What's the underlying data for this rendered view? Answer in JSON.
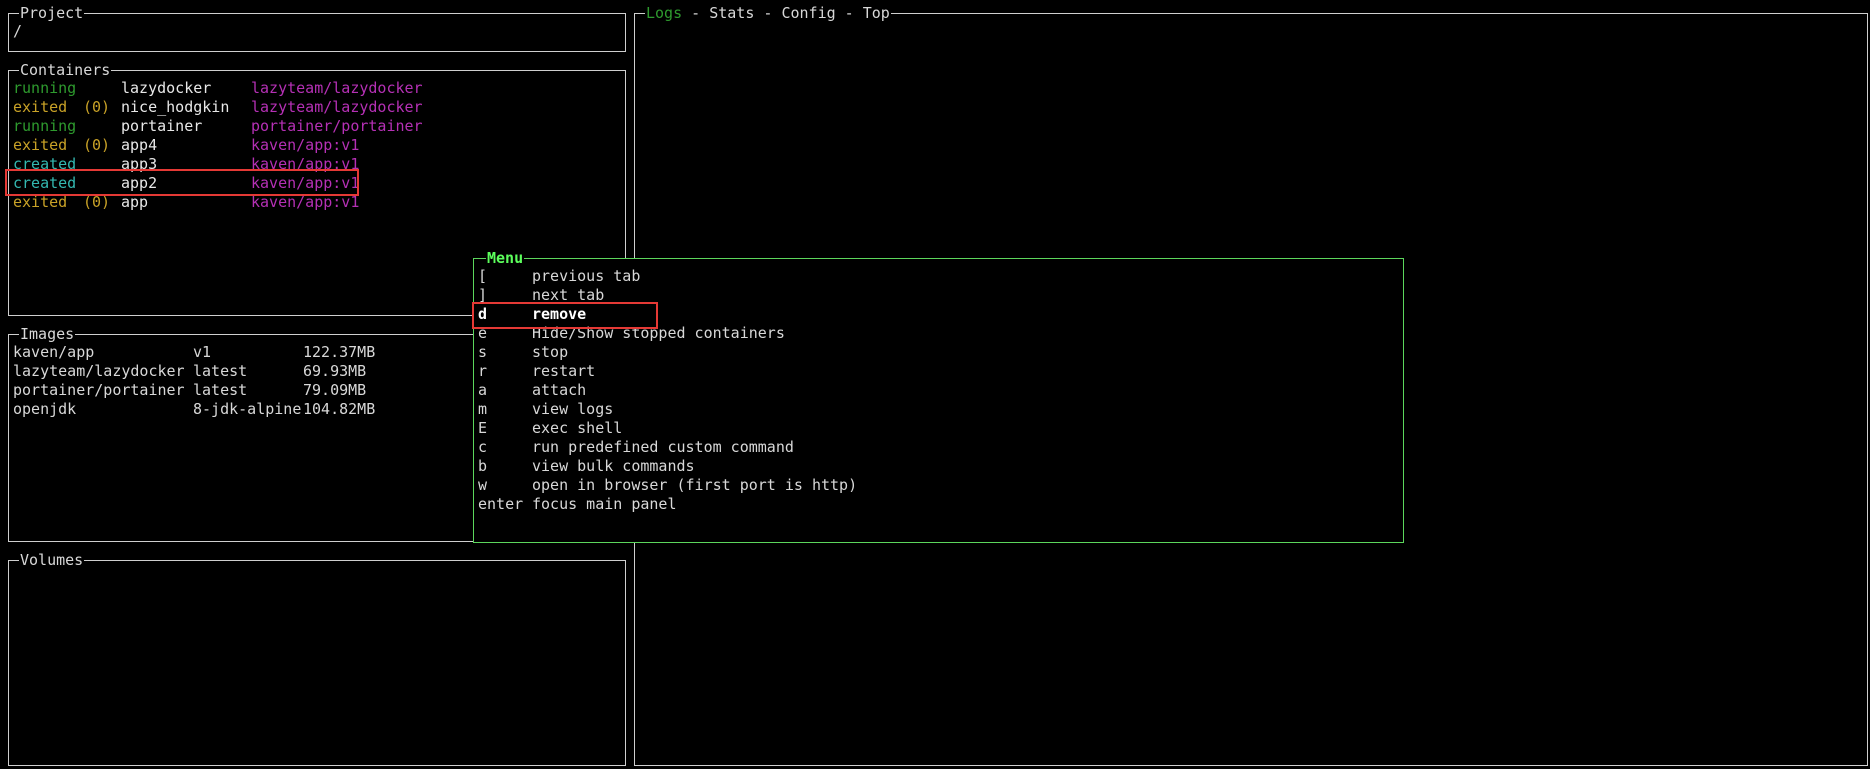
{
  "project": {
    "title": "Project",
    "path": "/"
  },
  "containers": {
    "title": "Containers",
    "rows": [
      {
        "status": "running",
        "code": "",
        "name": "lazydocker",
        "image": "lazyteam/lazydocker"
      },
      {
        "status": "exited",
        "code": "(0)",
        "name": "nice_hodgkin",
        "image": "lazyteam/lazydocker"
      },
      {
        "status": "running",
        "code": "",
        "name": "portainer",
        "image": "portainer/portainer"
      },
      {
        "status": "exited",
        "code": "(0)",
        "name": "app4",
        "image": "kaven/app:v1"
      },
      {
        "status": "created",
        "code": "",
        "name": "app3",
        "image": "kaven/app:v1"
      },
      {
        "status": "created",
        "code": "",
        "name": "app2",
        "image": "kaven/app:v1"
      },
      {
        "status": "exited",
        "code": "(0)",
        "name": "app",
        "image": "kaven/app:v1"
      }
    ]
  },
  "images": {
    "title": "Images",
    "rows": [
      {
        "name": "kaven/app",
        "tag": "v1",
        "size": "122.37MB"
      },
      {
        "name": "lazyteam/lazydocker",
        "tag": "latest",
        "size": "69.93MB"
      },
      {
        "name": "portainer/portainer",
        "tag": "latest",
        "size": "79.09MB"
      },
      {
        "name": "openjdk",
        "tag": "8-jdk-alpine",
        "size": "104.82MB"
      }
    ]
  },
  "volumes": {
    "title": "Volumes"
  },
  "main": {
    "tabs": [
      "Logs",
      "Stats",
      "Config",
      "Top"
    ],
    "separator": " - "
  },
  "menu": {
    "title": "Menu",
    "items": [
      {
        "key": "[",
        "label": "previous tab"
      },
      {
        "key": "]",
        "label": "next tab"
      },
      {
        "key": "d",
        "label": "remove"
      },
      {
        "key": "e",
        "label": "Hide/Show stopped containers"
      },
      {
        "key": "s",
        "label": "stop"
      },
      {
        "key": "r",
        "label": "restart"
      },
      {
        "key": "a",
        "label": "attach"
      },
      {
        "key": "m",
        "label": "view logs"
      },
      {
        "key": "E",
        "label": "exec shell"
      },
      {
        "key": "c",
        "label": "run predefined custom command"
      },
      {
        "key": "b",
        "label": "view bulk commands"
      },
      {
        "key": "w",
        "label": "open in browser (first port is http)"
      },
      {
        "key": "enter",
        "label": "focus main panel"
      }
    ]
  },
  "colors": {
    "running": "#2e9b2e",
    "exited": "#c9a227",
    "created": "#33b8b0",
    "image": "#b530b5",
    "menu_border": "#5cd65c",
    "highlight": "#e53935"
  }
}
